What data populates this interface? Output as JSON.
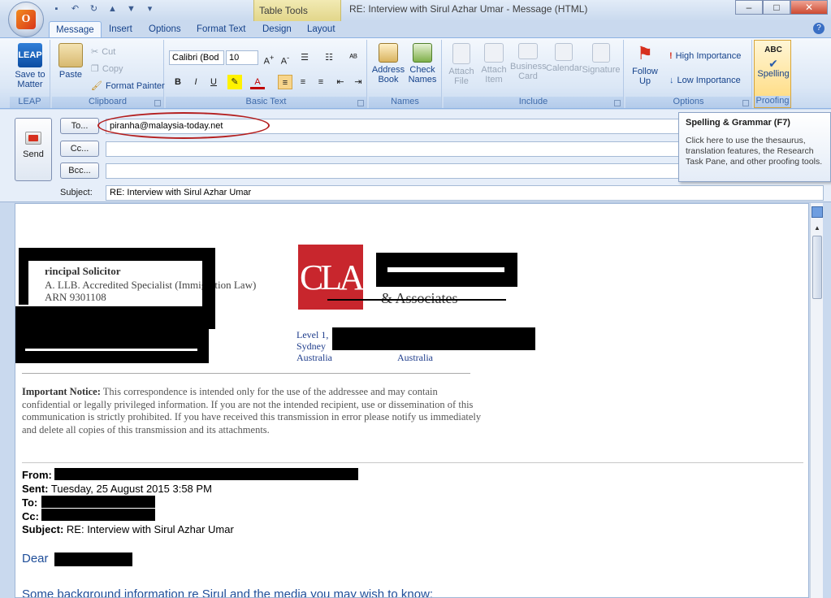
{
  "window": {
    "title": "RE: Interview with Sirul Azhar Umar - Message (HTML)",
    "context_tab": "Table Tools",
    "office_logo": "O"
  },
  "tabs": [
    "Message",
    "Insert",
    "Options",
    "Format Text",
    "Design",
    "Layout"
  ],
  "ribbon": {
    "leap": {
      "icon_text": "LEAP",
      "button": "Save to Matter",
      "group": "LEAP"
    },
    "clipboard": {
      "paste": "Paste",
      "cut": "Cut",
      "copy": "Copy",
      "format_painter": "Format Painter",
      "group": "Clipboard"
    },
    "basic_text": {
      "font": "Calibri (Bod",
      "size": "10",
      "group": "Basic Text",
      "bold": "B",
      "italic": "I",
      "underline": "U"
    },
    "names": {
      "address_book": "Address Book",
      "check_names": "Check Names",
      "group": "Names"
    },
    "include": {
      "attach_file": "Attach File",
      "attach_item": "Attach Item",
      "business_card": "Business Card",
      "calendar": "Calendar",
      "signature": "Signature",
      "group": "Include"
    },
    "options": {
      "follow_up": "Follow Up",
      "high": "High Importance",
      "low": "Low Importance",
      "group": "Options"
    },
    "proofing": {
      "icon_text": "ABC",
      "spelling": "Spelling",
      "group": "Proofing"
    }
  },
  "header": {
    "send": "Send",
    "to_btn": "To...",
    "cc_btn": "Cc...",
    "bcc_btn": "Bcc...",
    "to_value": "piranha@malaysia-today.net",
    "subject_label": "Subject:",
    "subject_value": "RE: Interview with Sirul Azhar Umar"
  },
  "tooltip": {
    "title": "Spelling & Grammar (F7)",
    "text": "Click here to use the thesaurus, translation features, the Research Task Pane, and other proofing tools."
  },
  "body": {
    "sig_title": "rincipal Solicitor",
    "sig_line1": "A. LLB. Accredited Specialist (Immigration Law)",
    "sig_line2": "ARN 9301108",
    "logo_text": "CLA",
    "firm_tail": "& Associates",
    "addr_level": "Level 1,",
    "addr_sydney": "Sydney",
    "addr_country1": "Australia",
    "addr_country2": "Australia",
    "notice_bold": "Important Notice:",
    "notice_text": " This correspondence is intended only for the use of the addressee and may contain confidential or legally privileged information.  If you are not the intended recipient, use or dissemination of this communication is strictly prohibited. If you have received this transmission in error please notify us immediately and delete all copies of this transmission and its attachments.",
    "from_label": "From:",
    "sent_label": "Sent:",
    "sent_value": " Tuesday, 25 August 2015 3:58 PM",
    "to_label": "To:",
    "cc_label": "Cc:",
    "subject_label": "Subject:",
    "subject_value": " RE: Interview with Sirul Azhar Umar",
    "dear": "Dear",
    "background": "Some background information re Sirul and the media you may wish to know:"
  }
}
